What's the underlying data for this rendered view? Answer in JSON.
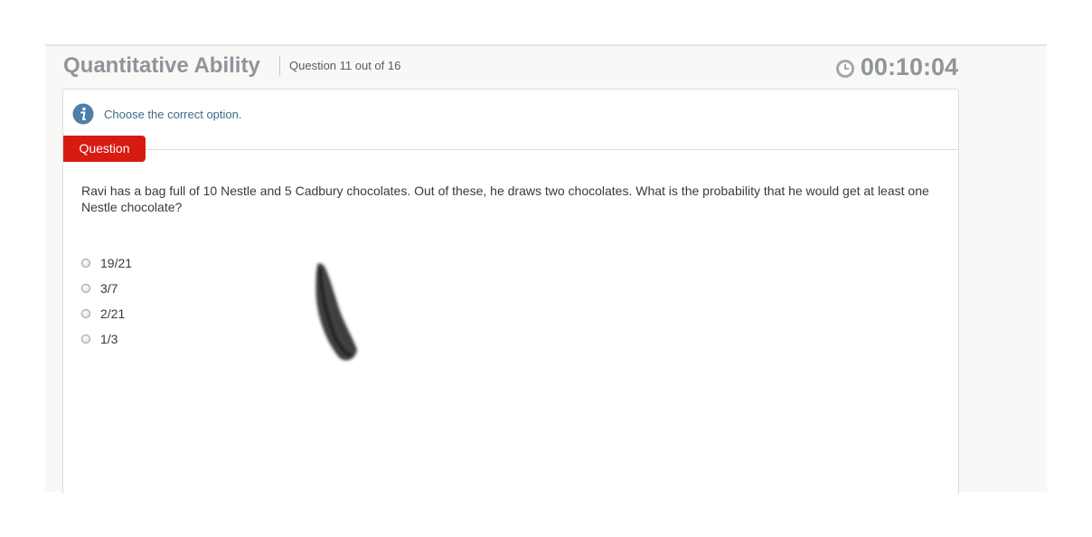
{
  "header": {
    "section_title": "Quantitative Ability",
    "question_counter": "Question 11 out of 16",
    "timer": "00:10:04"
  },
  "instruction": {
    "text": "Choose the correct option."
  },
  "question_tab": {
    "label": "Question"
  },
  "question": {
    "text": "Ravi has a bag full of 10 Nestle and 5 Cadbury chocolates. Out of these, he draws two chocolates. What is the probability that he would get at least one Nestle chocolate?"
  },
  "options": [
    {
      "label": "19/21",
      "selected": false
    },
    {
      "label": "3/7",
      "selected": false
    },
    {
      "label": "2/21",
      "selected": false
    },
    {
      "label": "1/3",
      "selected": false
    }
  ],
  "colors": {
    "accent_red": "#d81b12",
    "title_gray": "#8f959b",
    "info_blue": "#3f6a88"
  },
  "icons": {
    "timer": "clock-icon",
    "instruction": "info-icon"
  }
}
